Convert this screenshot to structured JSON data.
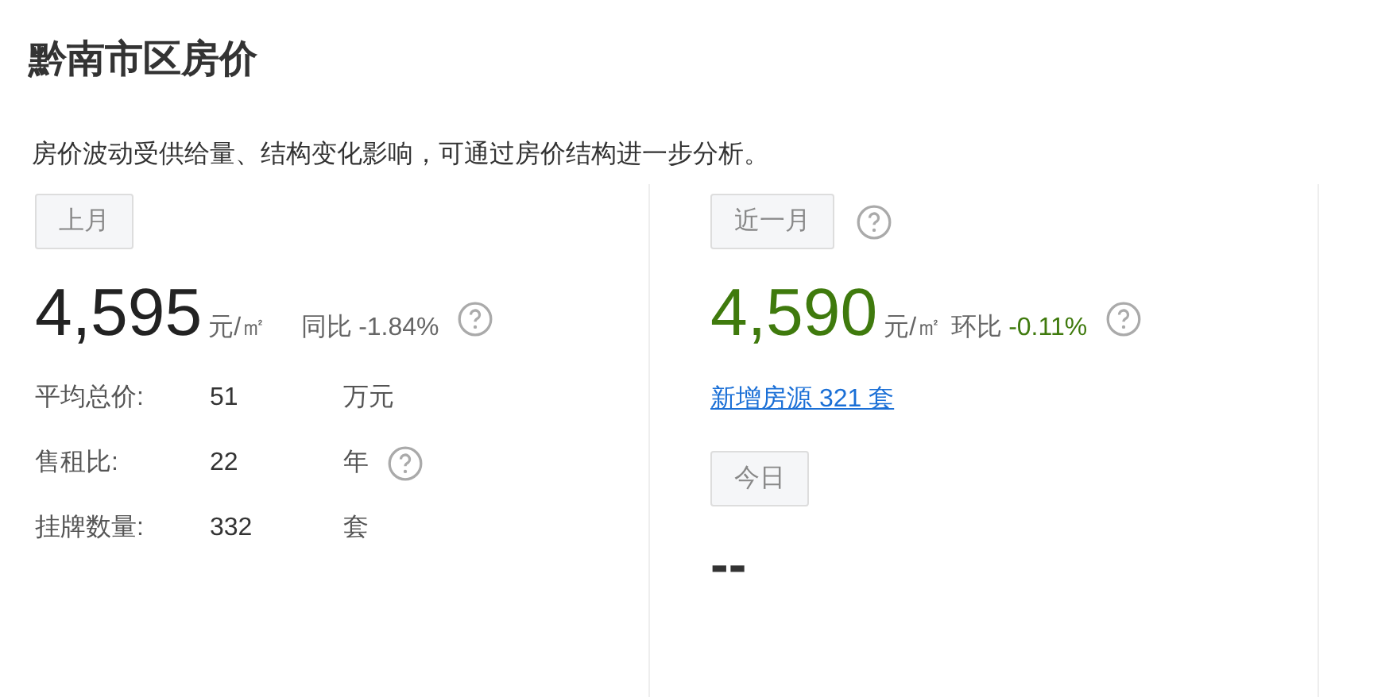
{
  "title": "黔南市区房价",
  "description": "房价波动受供给量、结构变化影响，可通过房价结构进一步分析。",
  "panels": [
    {
      "tag": "上月",
      "tag_help": false,
      "price": "4,595",
      "unit": "元/㎡",
      "change_label": "同比",
      "change_value": "-1.84%",
      "change_help": true,
      "highlight": false,
      "stats": [
        {
          "label": "平均总价:",
          "value": "51",
          "unit": "万元",
          "help": false
        },
        {
          "label": "售租比:",
          "value": "22",
          "unit": "年",
          "help": true
        },
        {
          "label": "挂牌数量:",
          "value": "332",
          "unit": "套",
          "help": false
        }
      ]
    },
    {
      "tag": "近一月",
      "tag_help": true,
      "price": "4,590",
      "unit": "元/㎡",
      "change_label": "环比",
      "change_value": "-0.11%",
      "change_help": true,
      "highlight": true,
      "link": "新增房源 321 套",
      "sub_tag": "今日",
      "sub_value": "--"
    }
  ]
}
